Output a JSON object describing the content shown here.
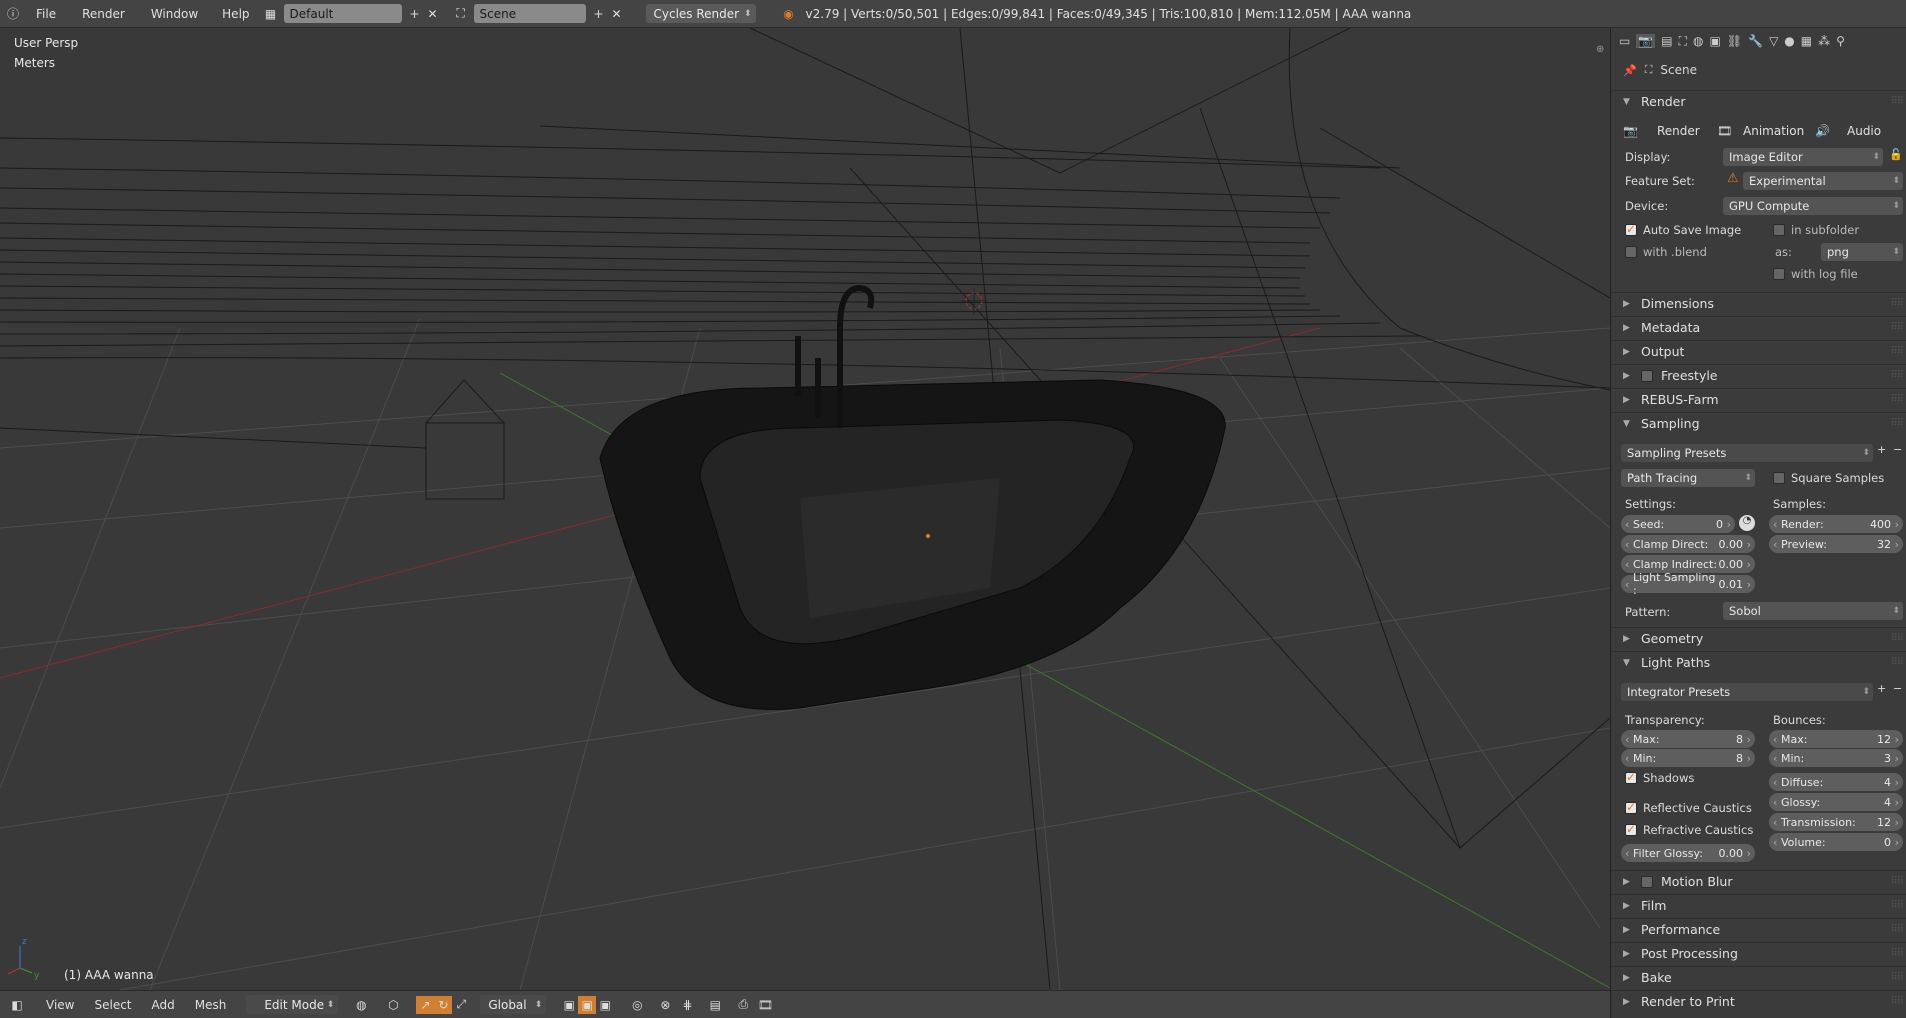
{
  "topbar": {
    "menus": [
      "File",
      "Render",
      "Window",
      "Help"
    ],
    "layout": "Default",
    "scene": "Scene",
    "engine": "Cycles Render",
    "stats": "v2.79 | Verts:0/50,501 | Edges:0/99,841 | Faces:0/49,345 | Tris:100,810 | Mem:112.05M | AAA wanna"
  },
  "viewport": {
    "view": "User Persp",
    "units": "Meters",
    "object": "(1) AAA wanna"
  },
  "bottombar": {
    "menus": [
      "View",
      "Select",
      "Add",
      "Mesh"
    ],
    "mode": "Edit Mode",
    "orientation": "Global"
  },
  "props": {
    "context": "Scene",
    "render": {
      "title": "Render",
      "tabs": [
        "Render",
        "Animation",
        "Audio"
      ],
      "display_label": "Display:",
      "display": "Image Editor",
      "featureset_label": "Feature Set:",
      "featureset": "Experimental",
      "device_label": "Device:",
      "device": "GPU Compute",
      "autosave": "Auto Save Image",
      "subfolder": "in subfolder",
      "withblend": "with .blend",
      "as_label": "as:",
      "format": "png",
      "logfile": "with log file"
    },
    "collapsed_a": [
      "Dimensions",
      "Metadata",
      "Output",
      "Freestyle",
      "REBUS-Farm"
    ],
    "sampling": {
      "title": "Sampling",
      "presets": "Sampling Presets",
      "method": "Path Tracing",
      "square": "Square Samples",
      "settings_label": "Settings:",
      "samples_label": "Samples:",
      "seed_label": "Seed:",
      "seed": "0",
      "clamp_direct_label": "Clamp Direct:",
      "clamp_direct": "0.00",
      "clamp_indirect_label": "Clamp Indirect:",
      "clamp_indirect": "0.00",
      "light_sampling_label": "Light Sampling :",
      "light_sampling": "0.01",
      "render_label": "Render:",
      "render": "400",
      "preview_label": "Preview:",
      "preview": "32",
      "pattern_label": "Pattern:",
      "pattern": "Sobol"
    },
    "geometry": "Geometry",
    "lightpaths": {
      "title": "Light Paths",
      "presets": "Integrator Presets",
      "transparency_label": "Transparency:",
      "bounces_label": "Bounces:",
      "t_max_label": "Max:",
      "t_max": "8",
      "t_min_label": "Min:",
      "t_min": "8",
      "shadows": "Shadows",
      "reflective": "Reflective Caustics",
      "refractive": "Refractive Caustics",
      "filter_label": "Filter Glossy:",
      "filter": "0.00",
      "b_max_label": "Max:",
      "b_max": "12",
      "b_min_label": "Min:",
      "b_min": "3",
      "diffuse_label": "Diffuse:",
      "diffuse": "4",
      "glossy_label": "Glossy:",
      "glossy": "4",
      "transmission_label": "Transmission:",
      "transmission": "12",
      "volume_label": "Volume:",
      "volume": "0"
    },
    "collapsed_b": [
      "Motion Blur",
      "Film",
      "Performance",
      "Post Processing",
      "Bake",
      "Render to Print"
    ]
  }
}
